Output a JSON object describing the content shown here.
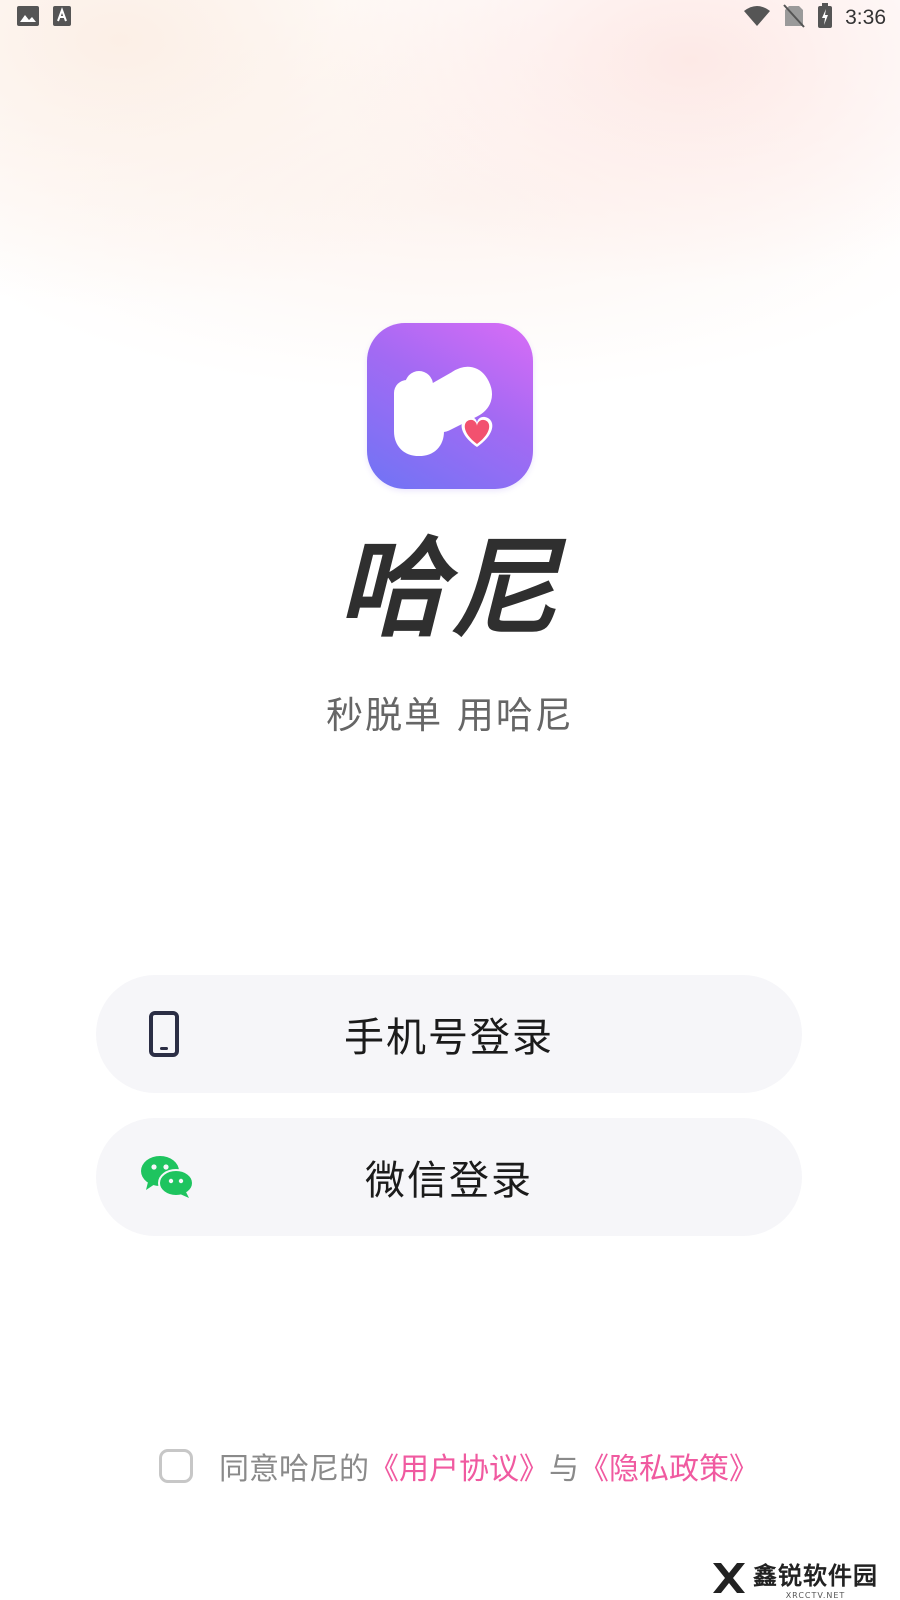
{
  "status_bar": {
    "time": "3:36",
    "left_icons": [
      "image-icon",
      "font-a-icon"
    ],
    "right_icons": [
      "wifi-icon",
      "no-sim-icon",
      "battery-charging-icon"
    ]
  },
  "app": {
    "name": "哈尼",
    "slogan": "秒脱单 用哈尼",
    "logo_icon": "hani-logo-icon",
    "colors": {
      "logo_gradient_start": "#d96cf6",
      "logo_gradient_end": "#6f74f5",
      "heart": "#f2516f"
    }
  },
  "login": {
    "phone_label": "手机号登录",
    "phone_icon": "mobile-phone-icon",
    "wechat_label": "微信登录",
    "wechat_icon": "wechat-icon",
    "wechat_color": "#1ec45f"
  },
  "agreement": {
    "prefix": "同意哈尼的",
    "user_agreement": "《用户协议》",
    "conjunction": "与",
    "privacy_policy": "《隐私政策》",
    "checked": false,
    "link_color": "#f05aa0"
  },
  "watermark": {
    "text": "鑫锐软件园",
    "sub": "XRCCTV.NET"
  }
}
